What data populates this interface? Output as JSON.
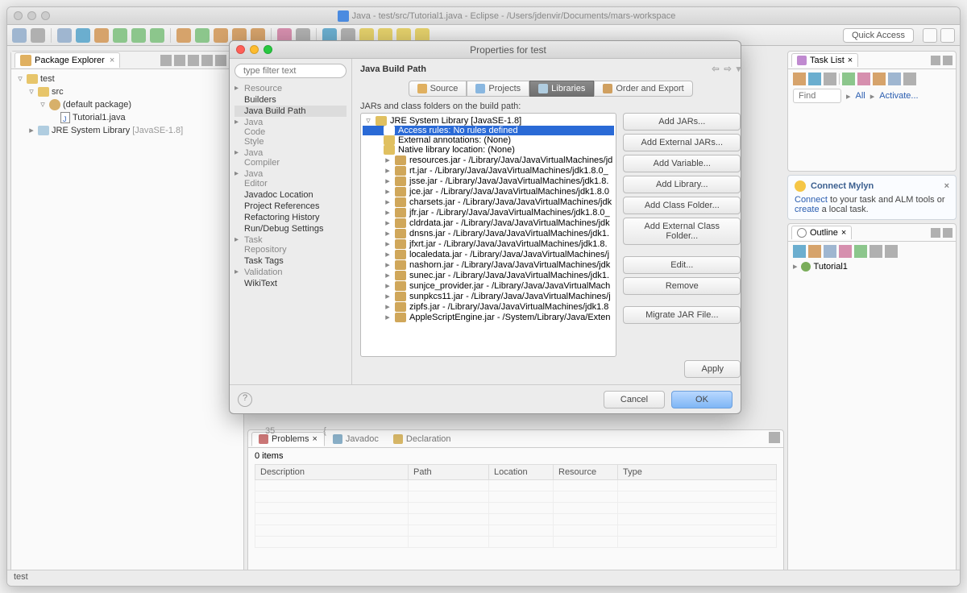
{
  "titlebar": "Java - test/src/Tutorial1.java - Eclipse - /Users/jdenvir/Documents/mars-workspace",
  "quick_access": "Quick Access",
  "package_explorer": {
    "title": "Package Explorer",
    "project": "test",
    "src": "src",
    "default_pkg": "(default package)",
    "file": "Tutorial1.java",
    "jre_lib": "JRE System Library",
    "jre_ver": "[JavaSE-1.8]"
  },
  "line_num": "35",
  "brace": "{",
  "problems": {
    "tab_problems": "Problems",
    "tab_javadoc": "Javadoc",
    "tab_decl": "Declaration",
    "items": "0 items",
    "cols": {
      "desc": "Description",
      "path": "Path",
      "loc": "Location",
      "res": "Resource",
      "type": "Type"
    }
  },
  "task_list": {
    "title": "Task List",
    "find": "Find",
    "all": "All",
    "activate": "Activate..."
  },
  "mylyn": {
    "title": "Connect Mylyn",
    "connect": "Connect",
    "text1": " to your task and ALM tools or ",
    "create": "create",
    "text2": " a local task."
  },
  "outline": {
    "title": "Outline",
    "item": "Tutorial1"
  },
  "status": "test",
  "dialog": {
    "title": "Properties for test",
    "filter_ph": "type filter text",
    "categories": [
      "Resource",
      "Builders",
      "Java Build Path",
      "Java Code Style",
      "Java Compiler",
      "Java Editor",
      "Javadoc Location",
      "Project References",
      "Refactoring History",
      "Run/Debug Settings",
      "Task Repository",
      "Task Tags",
      "Validation",
      "WikiText"
    ],
    "heading": "Java Build Path",
    "tabs": {
      "source": "Source",
      "projects": "Projects",
      "libraries": "Libraries",
      "order": "Order and Export"
    },
    "jar_label": "JARs and class folders on the build path:",
    "jre_root": "JRE System Library [JavaSE-1.8]",
    "access_rules": "Access rules: No rules defined",
    "ext_ann": "External annotations: (None)",
    "native_loc": "Native library location: (None)",
    "jars": [
      "resources.jar - /Library/Java/JavaVirtualMachines/jd",
      "rt.jar - /Library/Java/JavaVirtualMachines/jdk1.8.0_",
      "jsse.jar - /Library/Java/JavaVirtualMachines/jdk1.8.",
      "jce.jar - /Library/Java/JavaVirtualMachines/jdk1.8.0",
      "charsets.jar - /Library/Java/JavaVirtualMachines/jdk",
      "jfr.jar - /Library/Java/JavaVirtualMachines/jdk1.8.0_",
      "cldrdata.jar - /Library/Java/JavaVirtualMachines/jdk",
      "dnsns.jar - /Library/Java/JavaVirtualMachines/jdk1.",
      "jfxrt.jar - /Library/Java/JavaVirtualMachines/jdk1.8.",
      "localedata.jar - /Library/Java/JavaVirtualMachines/j",
      "nashorn.jar - /Library/Java/JavaVirtualMachines/jdk",
      "sunec.jar - /Library/Java/JavaVirtualMachines/jdk1.",
      "sunjce_provider.jar - /Library/Java/JavaVirtualMach",
      "sunpkcs11.jar - /Library/Java/JavaVirtualMachines/j",
      "zipfs.jar - /Library/Java/JavaVirtualMachines/jdk1.8",
      "AppleScriptEngine.jar - /System/Library/Java/Exten"
    ],
    "buttons": {
      "add_jars": "Add JARs...",
      "add_ext_jars": "Add External JARs...",
      "add_var": "Add Variable...",
      "add_lib": "Add Library...",
      "add_cls": "Add Class Folder...",
      "add_ext_cls": "Add External Class Folder...",
      "edit": "Edit...",
      "remove": "Remove",
      "migrate": "Migrate JAR File..."
    },
    "apply": "Apply",
    "cancel": "Cancel",
    "ok": "OK"
  }
}
